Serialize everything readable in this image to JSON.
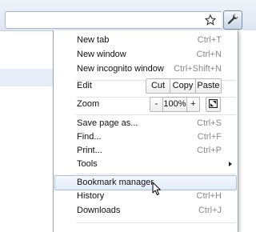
{
  "menu": {
    "group1": [
      {
        "label": "New tab",
        "shortcut": "Ctrl+T"
      },
      {
        "label": "New window",
        "shortcut": "Ctrl+N"
      },
      {
        "label": "New incognito window",
        "shortcut": "Ctrl+Shift+N"
      }
    ],
    "edit": {
      "label": "Edit",
      "cut": "Cut",
      "copy": "Copy",
      "paste": "Paste"
    },
    "zoom": {
      "label": "Zoom",
      "minus": "-",
      "level": "100%",
      "plus": "+"
    },
    "group2": [
      {
        "label": "Save page as...",
        "shortcut": "Ctrl+S"
      },
      {
        "label": "Find...",
        "shortcut": "Ctrl+F"
      },
      {
        "label": "Print...",
        "shortcut": "Ctrl+P"
      }
    ],
    "tools": {
      "label": "Tools"
    },
    "group3": [
      {
        "label": "Bookmark manager",
        "shortcut": ""
      },
      {
        "label": "History",
        "shortcut": "Ctrl+H"
      },
      {
        "label": "Downloads",
        "shortcut": "Ctrl+J"
      }
    ]
  },
  "icons": {
    "star": "star-icon",
    "wrench": "wrench-icon",
    "fullscreen": "fullscreen-icon",
    "submenu": "chevron-right-icon",
    "cursor": "mouse-pointer-icon"
  },
  "colors": {
    "hover_border": "#a8bfdd",
    "hover_fill": "#e2ecf9",
    "shortcut_text": "#8a8a8a"
  }
}
